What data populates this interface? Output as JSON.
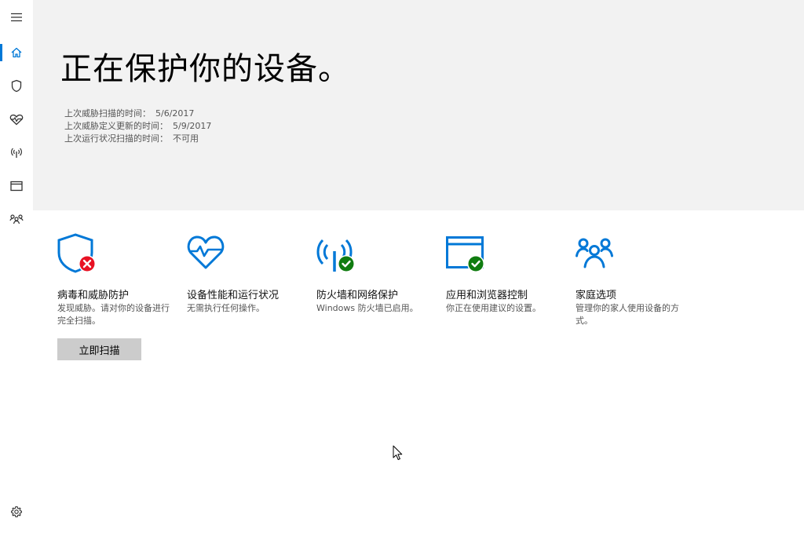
{
  "colors": {
    "accent": "#0078d7",
    "ok": "#107c10",
    "error": "#e81123",
    "hero_bg": "#f2f2f2",
    "button_bg": "#cccccc"
  },
  "sidebar": {
    "items": [
      {
        "icon": "hamburger-menu-icon"
      },
      {
        "icon": "home-icon",
        "active": true
      },
      {
        "icon": "shield-icon"
      },
      {
        "icon": "heart-health-icon"
      },
      {
        "icon": "wireless-signal-icon"
      },
      {
        "icon": "browser-window-icon"
      },
      {
        "icon": "family-people-icon"
      },
      {
        "icon": "gear-icon"
      }
    ]
  },
  "hero": {
    "title": "正在保护你的设备。",
    "scan_info": [
      {
        "label": "上次威胁扫描的时间：",
        "value": "5/6/2017"
      },
      {
        "label": "上次威胁定义更新的时间：",
        "value": "5/9/2017"
      },
      {
        "label": "上次运行状况扫描的时间：",
        "value": "不可用"
      }
    ]
  },
  "tiles": [
    {
      "icon": "shield-error-icon",
      "status": "error",
      "title": "病毒和威胁防护",
      "desc": "发现威胁。请对你的设备进行完全扫描。",
      "button": "立即扫描"
    },
    {
      "icon": "heart-health-icon",
      "status": "none",
      "title": "设备性能和运行状况",
      "desc": "无需执行任何操作。"
    },
    {
      "icon": "firewall-antenna-icon",
      "status": "ok",
      "title": "防火墙和网络保护",
      "desc": "Windows 防火墙已启用。"
    },
    {
      "icon": "browser-window-icon",
      "status": "ok",
      "title": "应用和浏览器控制",
      "desc": "你正在使用建议的设置。"
    },
    {
      "icon": "family-people-icon",
      "status": "none",
      "title": "家庭选项",
      "desc": "管理你的家人使用设备的方式。"
    }
  ]
}
